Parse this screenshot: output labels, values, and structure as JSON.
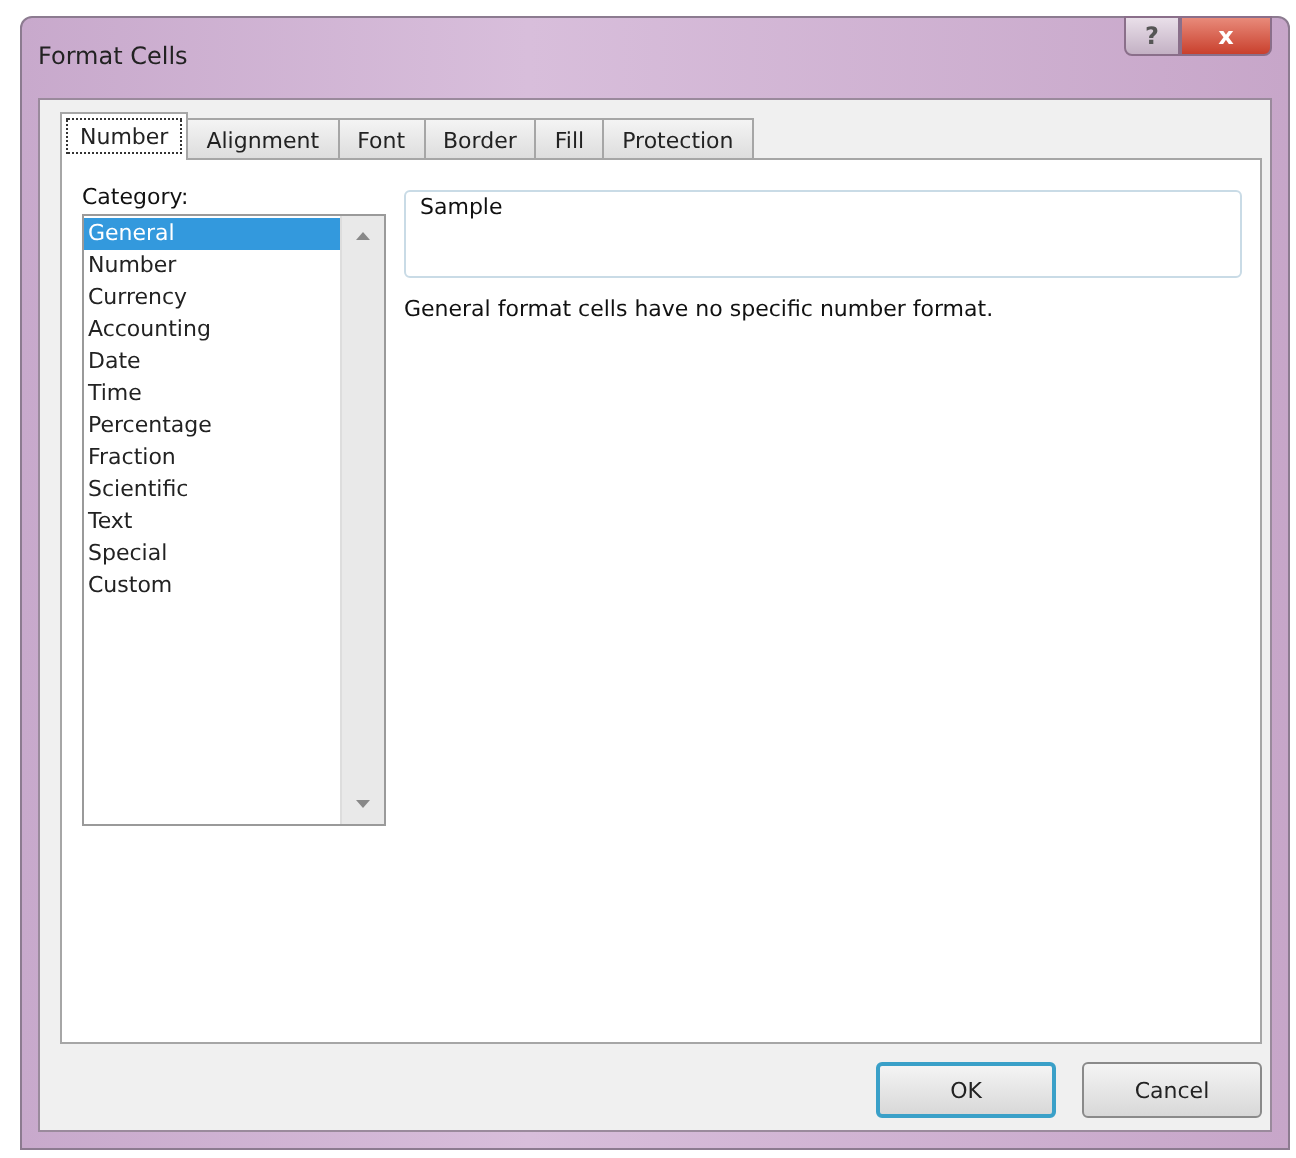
{
  "window": {
    "title": "Format Cells",
    "help_glyph": "?",
    "close_glyph": "x"
  },
  "tabs": [
    {
      "label": "Number",
      "selected": true
    },
    {
      "label": "Alignment",
      "selected": false
    },
    {
      "label": "Font",
      "selected": false
    },
    {
      "label": "Border",
      "selected": false
    },
    {
      "label": "Fill",
      "selected": false
    },
    {
      "label": "Protection",
      "selected": false
    }
  ],
  "category": {
    "label": "Category:",
    "items": [
      {
        "label": "General",
        "selected": true
      },
      {
        "label": "Number",
        "selected": false
      },
      {
        "label": "Currency",
        "selected": false
      },
      {
        "label": "Accounting",
        "selected": false
      },
      {
        "label": "Date",
        "selected": false
      },
      {
        "label": "Time",
        "selected": false
      },
      {
        "label": "Percentage",
        "selected": false
      },
      {
        "label": "Fraction",
        "selected": false
      },
      {
        "label": "Scientific",
        "selected": false
      },
      {
        "label": "Text",
        "selected": false
      },
      {
        "label": "Special",
        "selected": false
      },
      {
        "label": "Custom",
        "selected": false
      }
    ]
  },
  "sample": {
    "label": "Sample"
  },
  "description": "General format cells have no specific number format.",
  "buttons": [
    {
      "label": "OK",
      "default": true
    },
    {
      "label": "Cancel",
      "default": false
    }
  ]
}
